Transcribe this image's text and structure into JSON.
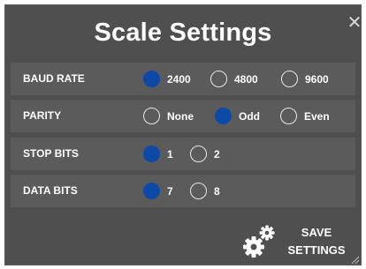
{
  "dialog": {
    "title": "Scale Settings",
    "close_icon": "close-icon"
  },
  "colors": {
    "panel": "#4f4f4f",
    "row": "#5b5b5b",
    "selected": "#0d4aa8",
    "text": "#ffffff"
  },
  "settings": {
    "baud_rate": {
      "label": "BAUD RATE",
      "options": [
        "2400",
        "4800",
        "9600"
      ],
      "selected": "2400"
    },
    "parity": {
      "label": "PARITY",
      "options": [
        "None",
        "Odd",
        "Even"
      ],
      "selected": "Odd"
    },
    "stop_bits": {
      "label": "STOP BITS",
      "options": [
        "1",
        "2"
      ],
      "selected": "1"
    },
    "data_bits": {
      "label": "DATA BITS",
      "options": [
        "7",
        "8"
      ],
      "selected": "7"
    }
  },
  "save": {
    "line1": "SAVE",
    "line2": "SETTINGS",
    "icon": "gears-icon"
  }
}
